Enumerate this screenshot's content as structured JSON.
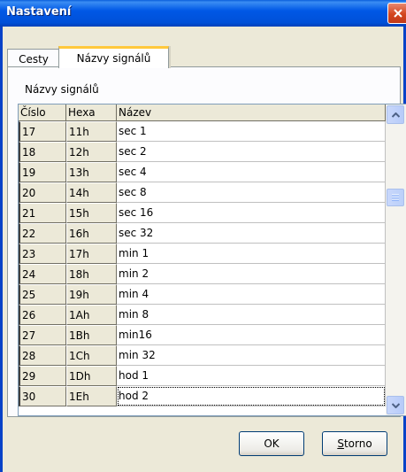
{
  "window": {
    "title": "Nastavení"
  },
  "tabs": [
    {
      "label": "Cesty"
    },
    {
      "label": "Názvy signálů"
    }
  ],
  "section_label": "Názvy signálů",
  "table": {
    "columns": [
      "Číslo",
      "Hexa",
      "Název"
    ],
    "rows": [
      {
        "num": "17",
        "hex": "11h",
        "name": "sec 1"
      },
      {
        "num": "18",
        "hex": "12h",
        "name": "sec 2"
      },
      {
        "num": "19",
        "hex": "13h",
        "name": "sec 4"
      },
      {
        "num": "20",
        "hex": "14h",
        "name": "sec 8"
      },
      {
        "num": "21",
        "hex": "15h",
        "name": "sec 16"
      },
      {
        "num": "22",
        "hex": "16h",
        "name": "sec 32"
      },
      {
        "num": "23",
        "hex": "17h",
        "name": "min 1"
      },
      {
        "num": "24",
        "hex": "18h",
        "name": "min 2"
      },
      {
        "num": "25",
        "hex": "19h",
        "name": "min 4"
      },
      {
        "num": "26",
        "hex": "1Ah",
        "name": "min 8"
      },
      {
        "num": "27",
        "hex": "1Bh",
        "name": "min16"
      },
      {
        "num": "28",
        "hex": "1Ch",
        "name": "min 32"
      },
      {
        "num": "29",
        "hex": "1Dh",
        "name": "hod 1"
      },
      {
        "num": "30",
        "hex": "1Eh",
        "name": "hod 2"
      }
    ]
  },
  "buttons": {
    "ok": "OK",
    "storno_first": "S",
    "storno_rest": "torno"
  },
  "icons": {
    "close": "close-icon",
    "scroll_up": "chevron-up-icon",
    "scroll_down": "chevron-down-icon"
  }
}
